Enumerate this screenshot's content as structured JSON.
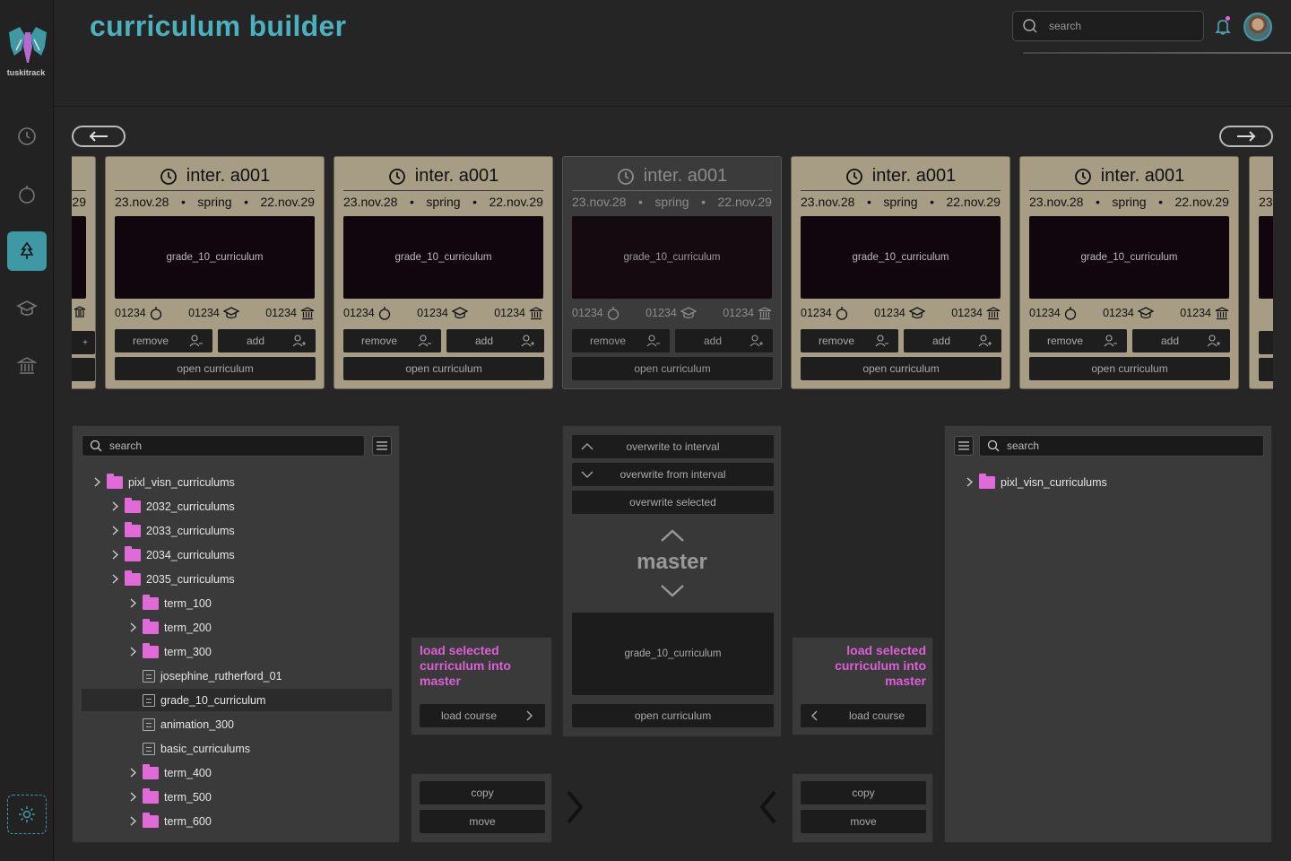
{
  "app": {
    "logo_text": "tuskitrack",
    "title": "curriculum builder"
  },
  "header": {
    "search_placeholder": "search"
  },
  "sidebar": {
    "items": [
      {
        "icon": "clock-icon"
      },
      {
        "icon": "timer-icon"
      },
      {
        "icon": "tree-icon",
        "active": true
      },
      {
        "icon": "graduation-cap-icon"
      },
      {
        "icon": "institution-icon"
      }
    ],
    "settings_icon": "gear-icon"
  },
  "carousel": {
    "partial_left": {
      "date_fragment": "29",
      "count": "",
      "remove_fragment": "+",
      "add_fragment": ""
    },
    "partial_right": {
      "date_fragment": "23"
    },
    "cards": [
      {
        "title": "inter. a001",
        "start": "23.nov.28",
        "term": "spring",
        "end": "22.nov.29",
        "thumb": "grade_10_curriculum",
        "stat1": "01234",
        "stat2": "01234",
        "stat3": "01234",
        "remove": "remove",
        "add": "add",
        "open": "open curriculum",
        "dim": false
      },
      {
        "title": "inter. a001",
        "start": "23.nov.28",
        "term": "spring",
        "end": "22.nov.29",
        "thumb": "grade_10_curriculum",
        "stat1": "01234",
        "stat2": "01234",
        "stat3": "01234",
        "remove": "remove",
        "add": "add",
        "open": "open curriculum",
        "dim": false
      },
      {
        "title": "inter. a001",
        "start": "23.nov.28",
        "term": "spring",
        "end": "22.nov.29",
        "thumb": "grade_10_curriculum",
        "stat1": "01234",
        "stat2": "01234",
        "stat3": "01234",
        "remove": "remove",
        "add": "add",
        "open": "open curriculum",
        "dim": true
      },
      {
        "title": "inter. a001",
        "start": "23.nov.28",
        "term": "spring",
        "end": "22.nov.29",
        "thumb": "grade_10_curriculum",
        "stat1": "01234",
        "stat2": "01234",
        "stat3": "01234",
        "remove": "remove",
        "add": "add",
        "open": "open curriculum",
        "dim": false
      },
      {
        "title": "inter. a001",
        "start": "23.nov.28",
        "term": "spring",
        "end": "22.nov.29",
        "thumb": "grade_10_curriculum",
        "stat1": "01234",
        "stat2": "01234",
        "stat3": "01234",
        "remove": "remove",
        "add": "add",
        "open": "open curriculum",
        "dim": false
      }
    ]
  },
  "left_panel": {
    "search_placeholder": "search",
    "tree": [
      {
        "label": "pixl_visn_curriculums",
        "type": "folder",
        "depth": 0
      },
      {
        "label": "2032_curriculums",
        "type": "folder",
        "depth": 1
      },
      {
        "label": "2033_curriculums",
        "type": "folder",
        "depth": 1
      },
      {
        "label": "2034_curriculums",
        "type": "folder",
        "depth": 1
      },
      {
        "label": "2035_curriculums",
        "type": "folder",
        "depth": 1
      },
      {
        "label": "term_100",
        "type": "folder",
        "depth": 2
      },
      {
        "label": "term_200",
        "type": "folder",
        "depth": 2
      },
      {
        "label": "term_300",
        "type": "folder",
        "depth": 2
      },
      {
        "label": "josephine_rutherford_01",
        "type": "doc",
        "depth": 2
      },
      {
        "label": "grade_10_curriculum",
        "type": "doc",
        "depth": 2,
        "selected": true
      },
      {
        "label": "animation_300",
        "type": "doc",
        "depth": 2
      },
      {
        "label": "basic_curriculums",
        "type": "doc",
        "depth": 2
      },
      {
        "label": "term_400",
        "type": "folder",
        "depth": 2
      },
      {
        "label": "term_500",
        "type": "folder",
        "depth": 2
      },
      {
        "label": "term_600",
        "type": "folder",
        "depth": 2
      }
    ]
  },
  "left_load": {
    "title": "load selected curriculum into master",
    "button": "load course"
  },
  "left_transfer": {
    "copy": "copy",
    "move": "move"
  },
  "master": {
    "overwrite_to": "overwrite to interval",
    "overwrite_from": "overwrite from interval",
    "overwrite_selected": "overwrite selected",
    "label": "master",
    "thumb": "grade_10_curriculum",
    "open": "open curriculum"
  },
  "right_load": {
    "title": "load selected curriculum into master",
    "button": "load course"
  },
  "right_transfer": {
    "copy": "copy",
    "move": "move"
  },
  "right_panel": {
    "search_placeholder": "search",
    "tree": [
      {
        "label": "pixl_visn_curriculums",
        "type": "folder",
        "depth": 0
      }
    ]
  },
  "colors": {
    "accent": "#4bb1bd",
    "highlight": "#dd5fd8",
    "card": "#a79c84"
  }
}
